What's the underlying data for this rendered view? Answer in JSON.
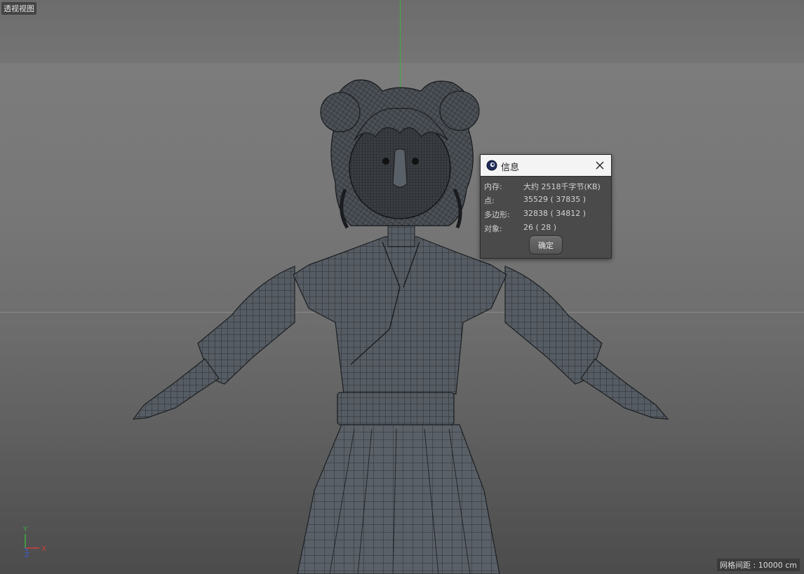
{
  "viewport": {
    "label": "透视视图",
    "grid_spacing": "网格间距 : 10000 cm"
  },
  "axis_gizmo": {
    "y": "Y",
    "x": "X",
    "z": "Z"
  },
  "info_dialog": {
    "title": "信息",
    "rows": [
      {
        "label": "内存:",
        "value": "大约 2518千字节(KB)"
      },
      {
        "label": "点:",
        "value": "35529 ( 37835 )"
      },
      {
        "label": "多边形:",
        "value": "32838 ( 34812 )"
      },
      {
        "label": "对象:",
        "value": "26 ( 28 )"
      }
    ],
    "ok_label": "确定"
  },
  "colors": {
    "axis_y": "#3fae3f",
    "axis_x": "#d23b3b",
    "axis_z": "#3b5bd2",
    "mesh_fill": "#4e545a",
    "wire": "#1c1f22"
  }
}
